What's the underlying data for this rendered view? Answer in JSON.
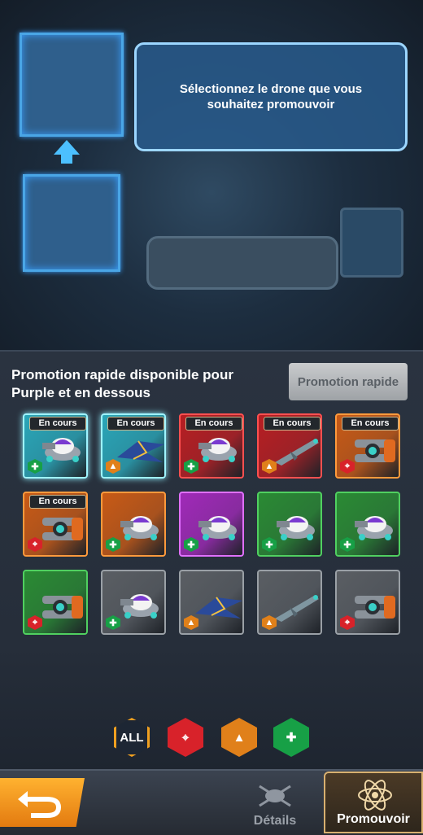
{
  "header": {
    "instruction": "Sélectionnez le drone que vous souhaitez promouvoir"
  },
  "promotion": {
    "text": "Promotion rapide disponible pour Purple et en dessous",
    "button_label": "Promotion rapide"
  },
  "drones": [
    {
      "tag": "En cours",
      "rarity": "cyan",
      "type": "support",
      "model": "saucer"
    },
    {
      "tag": "En cours",
      "rarity": "cyan",
      "type": "attack",
      "model": "jet"
    },
    {
      "tag": "En cours",
      "rarity": "red",
      "type": "support",
      "model": "saucer"
    },
    {
      "tag": "En cours",
      "rarity": "red",
      "type": "attack",
      "model": "missile"
    },
    {
      "tag": "En cours",
      "rarity": "orange",
      "type": "target",
      "model": "cannon"
    },
    {
      "tag": "En cours",
      "rarity": "orange",
      "type": "target",
      "model": "cannon"
    },
    {
      "tag": "",
      "rarity": "orange",
      "type": "support",
      "model": "saucer"
    },
    {
      "tag": "",
      "rarity": "purple",
      "type": "support",
      "model": "saucer"
    },
    {
      "tag": "",
      "rarity": "green",
      "type": "support",
      "model": "saucer"
    },
    {
      "tag": "",
      "rarity": "green",
      "type": "support",
      "model": "saucer"
    },
    {
      "tag": "",
      "rarity": "green",
      "type": "target",
      "model": "cannon"
    },
    {
      "tag": "",
      "rarity": "gray",
      "type": "support",
      "model": "saucer"
    },
    {
      "tag": "",
      "rarity": "gray",
      "type": "attack",
      "model": "jet"
    },
    {
      "tag": "",
      "rarity": "gray",
      "type": "attack",
      "model": "missile"
    },
    {
      "tag": "",
      "rarity": "gray",
      "type": "target",
      "model": "cannon"
    }
  ],
  "filters": {
    "all_label": "ALL"
  },
  "tabs": {
    "details_label": "Détails",
    "promote_label": "Promouvoir"
  },
  "colors": {
    "cyan": "#2aa6b8",
    "red": "#b81e22",
    "orange": "#c85a16",
    "purple": "#a02ab8",
    "green": "#2a8a34",
    "gray": "#5a5e63",
    "accent": "#ffb230"
  }
}
